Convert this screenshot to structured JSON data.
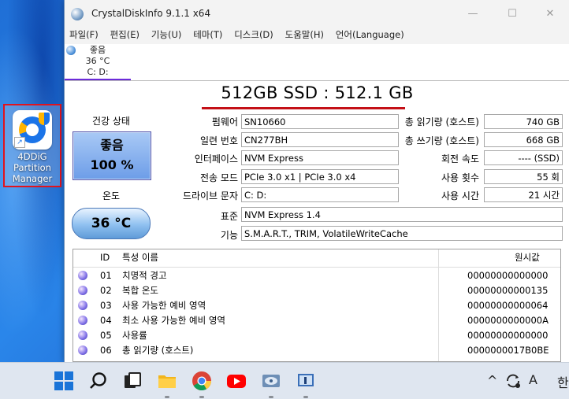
{
  "desktop": {
    "icon_label": "4DDiG\nPartition\nManager",
    "icon_lines": [
      "4DDiG",
      "Partition",
      "Manager"
    ]
  },
  "window": {
    "title": "CrystalDiskInfo 9.1.1 x64",
    "controls": {
      "minimize": "—",
      "maximize": "☐",
      "close": "✕"
    }
  },
  "menu": [
    "파일(F)",
    "편집(E)",
    "기능(U)",
    "테마(T)",
    "디스크(D)",
    "도움말(H)",
    "언어(Language)"
  ],
  "disk_tab": {
    "status": "좋음",
    "temp": "36 °C",
    "drive": "C: D:"
  },
  "model": "512GB SSD : 512.1 GB",
  "health": {
    "label": "건강 상태",
    "status": "좋음",
    "percent": "100 %"
  },
  "temperature": {
    "label": "온도",
    "value": "36 °C"
  },
  "fields_left": [
    {
      "label": "펌웨어",
      "value": "SN10660"
    },
    {
      "label": "일련 번호",
      "value": "CN277BH"
    },
    {
      "label": "인터페이스",
      "value": "NVM Express"
    },
    {
      "label": "전송 모드",
      "value": "PCIe 3.0 x1 | PCIe 3.0 x4"
    },
    {
      "label": "드라이브 문자",
      "value": "C: D:"
    }
  ],
  "fields_right": [
    {
      "label": "총 읽기량 (호스트)",
      "value": "740 GB"
    },
    {
      "label": "총 쓰기량 (호스트)",
      "value": "668 GB"
    },
    {
      "label": "회전 속도",
      "value": "---- (SSD)"
    },
    {
      "label": "사용 횟수",
      "value": "55 회"
    },
    {
      "label": "사용 시간",
      "value": "21 시간"
    }
  ],
  "standard": {
    "label": "표준",
    "value": "NVM Express 1.4"
  },
  "features": {
    "label": "기능",
    "value": "S.M.A.R.T., TRIM, VolatileWriteCache"
  },
  "smart_table": {
    "headers": {
      "id": "ID",
      "name": "특성 이름",
      "raw": "원시값"
    },
    "rows": [
      {
        "id": "01",
        "name": "치명적 경고",
        "raw": "00000000000000"
      },
      {
        "id": "02",
        "name": "복합 온도",
        "raw": "00000000000135"
      },
      {
        "id": "03",
        "name": "사용 가능한 예비 영역",
        "raw": "00000000000064"
      },
      {
        "id": "04",
        "name": "최소 사용 가능한 예비 영역",
        "raw": "0000000000000A"
      },
      {
        "id": "05",
        "name": "사용률",
        "raw": "00000000000000"
      },
      {
        "id": "06",
        "name": "총 읽기량 (호스트)",
        "raw": "0000000017B0BE"
      }
    ]
  },
  "taskbar": {
    "apps": [
      "start-icon",
      "search-icon",
      "task-view-icon",
      "file-explorer-icon",
      "chrome-icon",
      "youtube-icon",
      "crystaldiskinfo-icon",
      "app-icon"
    ],
    "tray": {
      "chevron": "^",
      "ime": "A",
      "lang": "한"
    }
  }
}
